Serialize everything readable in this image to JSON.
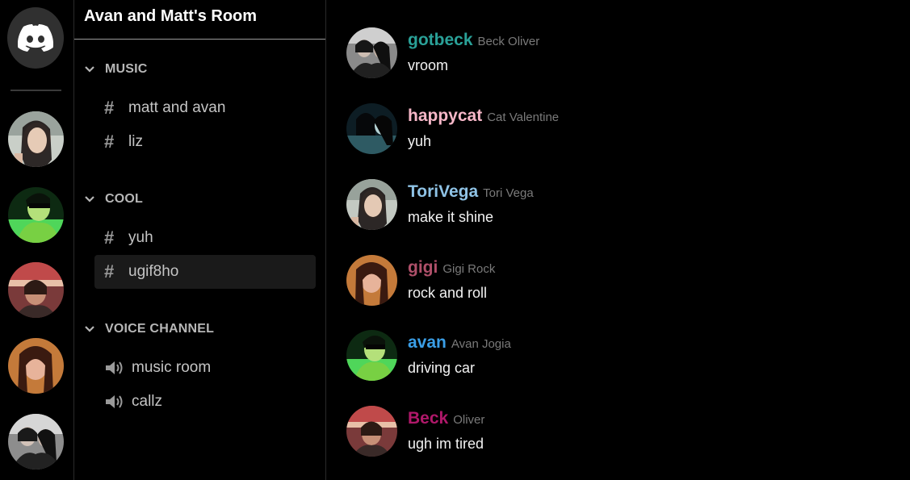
{
  "rail": {
    "home_icon": "discord-logo-icon",
    "servers": [
      "server-1",
      "server-2",
      "server-3",
      "server-4",
      "server-5"
    ]
  },
  "room": {
    "title": "Avan and Matt's Room"
  },
  "categories": [
    {
      "name": "MUSIC",
      "channels": [
        {
          "label": "matt and avan",
          "type": "text"
        },
        {
          "label": "liz",
          "type": "text"
        }
      ]
    },
    {
      "name": "COOL",
      "channels": [
        {
          "label": "yuh",
          "type": "text"
        },
        {
          "label": "ugif8ho",
          "type": "text",
          "active": true
        }
      ]
    },
    {
      "name": "VOICE CHANNEL",
      "channels": [
        {
          "label": "music room",
          "type": "voice"
        },
        {
          "label": "callz",
          "type": "voice"
        }
      ]
    }
  ],
  "messages": [
    {
      "username": "gotbeck",
      "realname": "Beck Oliver",
      "text": "vroom",
      "color": "#2aa198"
    },
    {
      "username": "happycat",
      "realname": "Cat Valentine",
      "text": "yuh",
      "color": "#f7b7c8"
    },
    {
      "username": "ToriVega",
      "realname": "Tori Vega",
      "text": "make it shine",
      "color": "#8fc3e6"
    },
    {
      "username": "gigi",
      "realname": "Gigi Rock",
      "text": "rock and roll",
      "color": "#b0506a"
    },
    {
      "username": "avan",
      "realname": "Avan Jogia",
      "text": "driving car",
      "color": "#3a9ee6"
    },
    {
      "username": "Beck",
      "realname": "Oliver",
      "text": "ugh im tired",
      "color": "#b0186a"
    }
  ],
  "colors": {
    "background": "#000000",
    "active_channel": "#1a1a1a",
    "category_text": "#b7b7b7",
    "channel_text": "#c4c4c4"
  }
}
